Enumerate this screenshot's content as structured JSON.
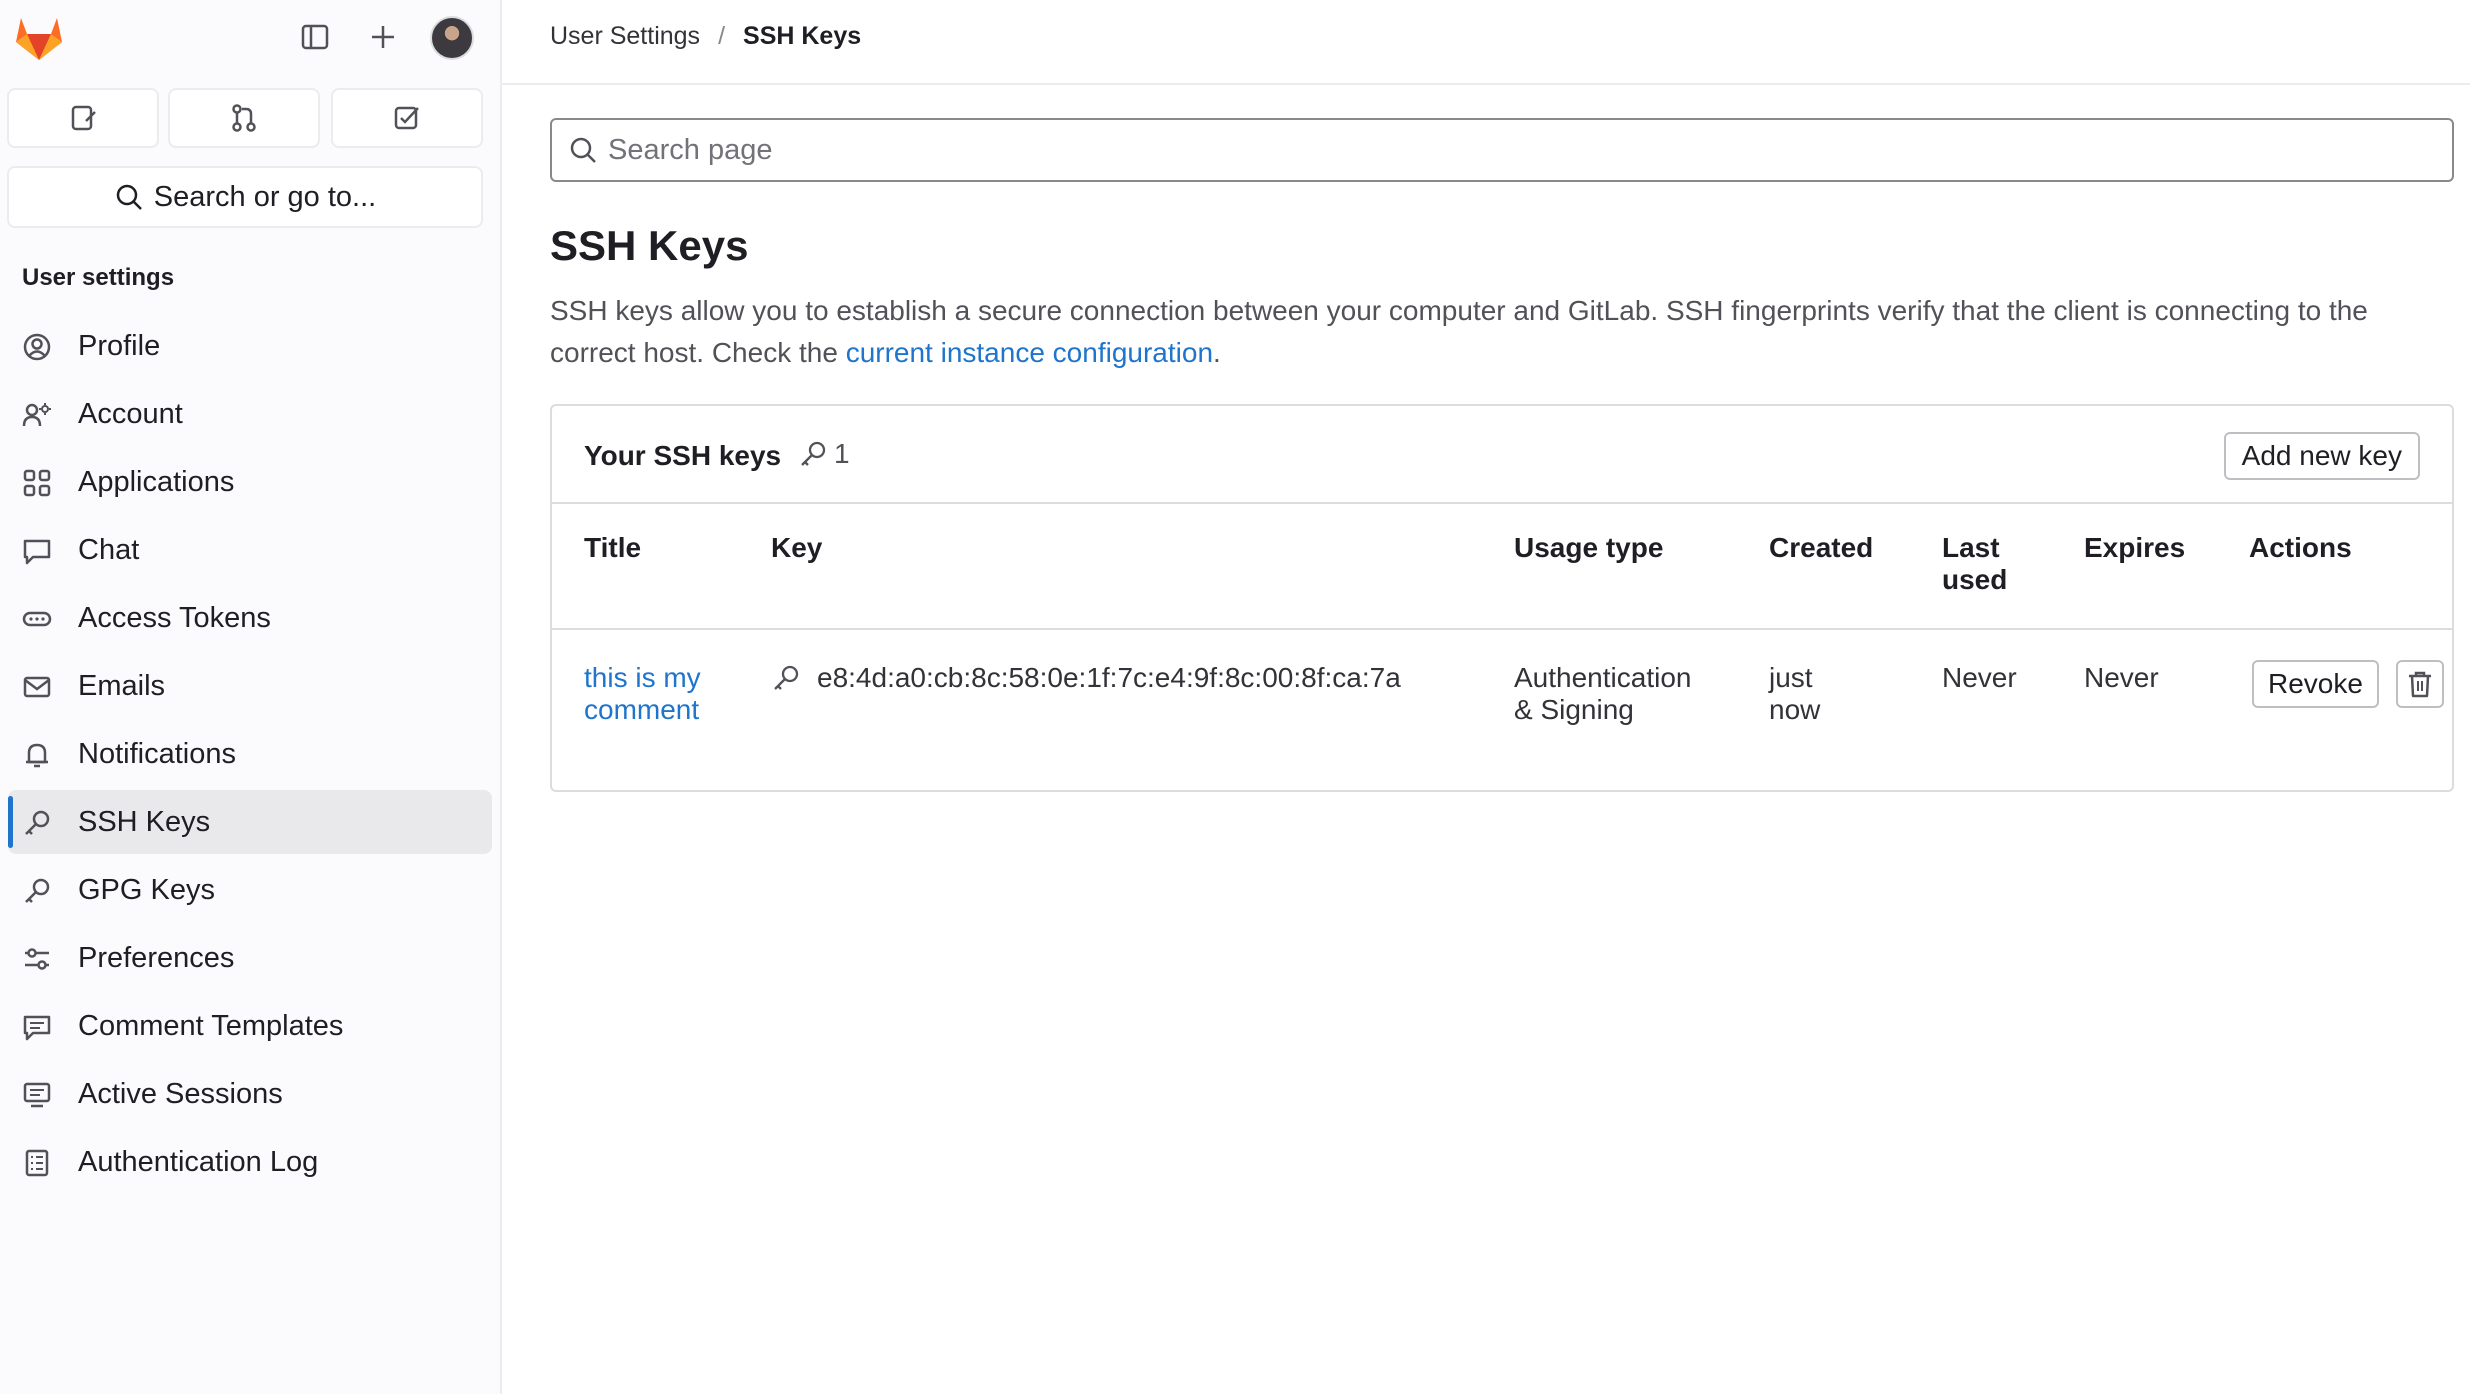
{
  "sidebar": {
    "heading": "User settings",
    "search_label": "Search or go to...",
    "items": [
      {
        "label": "Profile",
        "icon": "profile-icon"
      },
      {
        "label": "Account",
        "icon": "account-icon"
      },
      {
        "label": "Applications",
        "icon": "applications-icon"
      },
      {
        "label": "Chat",
        "icon": "chat-icon"
      },
      {
        "label": "Access Tokens",
        "icon": "token-icon"
      },
      {
        "label": "Emails",
        "icon": "mail-icon"
      },
      {
        "label": "Notifications",
        "icon": "bell-icon"
      },
      {
        "label": "SSH Keys",
        "icon": "key-icon",
        "active": true
      },
      {
        "label": "GPG Keys",
        "icon": "key-icon"
      },
      {
        "label": "Preferences",
        "icon": "preferences-icon"
      },
      {
        "label": "Comment Templates",
        "icon": "comment-icon"
      },
      {
        "label": "Active Sessions",
        "icon": "monitor-icon"
      },
      {
        "label": "Authentication Log",
        "icon": "log-icon"
      }
    ]
  },
  "breadcrumb": {
    "parent": "User Settings",
    "separator": "/",
    "current": "SSH Keys"
  },
  "search": {
    "placeholder": "Search page"
  },
  "page": {
    "title": "SSH Keys",
    "description_prefix": "SSH keys allow you to establish a secure connection between your computer and GitLab. SSH fingerprints verify that the client is connecting to the correct host. Check the ",
    "description_link": "current instance configuration",
    "description_suffix": "."
  },
  "keys_card": {
    "title": "Your SSH keys",
    "count": "1",
    "add_button": "Add new key",
    "columns": {
      "title": "Title",
      "key": "Key",
      "usage": "Usage type",
      "created": "Created",
      "last_used_1": "Last",
      "last_used_2": "used",
      "expires": "Expires",
      "actions": "Actions"
    },
    "row": {
      "title": "this is my comment",
      "fingerprint": "e8:4d:a0:cb:8c:58:0e:1f:7c:e4:9f:8c:00:8f:ca:7a",
      "usage_1": "Authentication",
      "usage_2": "& Signing",
      "created_1": "just",
      "created_2": "now",
      "last_used": "Never",
      "expires": "Never",
      "revoke": "Revoke"
    }
  },
  "colors": {
    "accent": "#1f75cb",
    "sidebar_bg": "#fbfafd",
    "active_bg": "#e9e9ec",
    "brand_orange": "#fc6d26"
  }
}
